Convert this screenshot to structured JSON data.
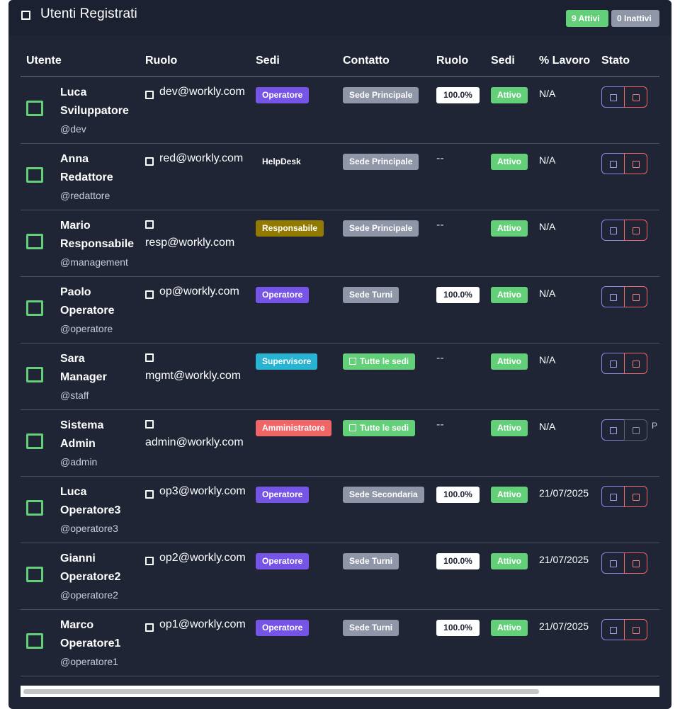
{
  "header": {
    "title": "Utenti Registrati",
    "active_badge": "9 Attivi",
    "inactive_badge": "0 Inattivi"
  },
  "columns": [
    "Utente",
    "Ruolo",
    "Sedi",
    "Contatto",
    "Ruolo",
    "Sedi",
    "% Lavoro",
    "Stato"
  ],
  "colors": {
    "card_bg": "#1f2535",
    "green": "#63cf78",
    "gray": "#8e96a8",
    "operatore": "#7654e6",
    "responsabile": "#927a00",
    "supervisore": "#28b3d2",
    "amministratore": "#f06666",
    "edit_outline": "#8d86e8",
    "delete_outline": "#f06666"
  },
  "users": [
    {
      "name_l1": "Luca",
      "name_l2": "Sviluppatore",
      "username": "@dev",
      "email": "dev@workly.com",
      "role": "Operatore",
      "role_color": "#7654e6",
      "sede": "Sede Principale",
      "sede_style": "gray",
      "perc": "100.0%",
      "stato": "Attivo",
      "lavoro": "N/A"
    },
    {
      "name_l1": "Anna",
      "name_l2": "Redattore",
      "username": "@redattore",
      "email": "red@workly.com",
      "role": "HelpDesk",
      "role_color": "transparent",
      "sede": "Sede Principale",
      "sede_style": "gray",
      "perc": "--",
      "stato": "Attivo",
      "lavoro": "N/A"
    },
    {
      "name_l1": "Mario",
      "name_l2": "Responsabile",
      "username": "@management",
      "email": "resp@workly.com",
      "role": "Responsabile",
      "role_color": "#927a00",
      "sede": "Sede Principale",
      "sede_style": "gray",
      "perc": "--",
      "stato": "Attivo",
      "lavoro": "N/A"
    },
    {
      "name_l1": "Paolo",
      "name_l2": "Operatore",
      "username": "@operatore",
      "email": "op@workly.com",
      "role": "Operatore",
      "role_color": "#7654e6",
      "sede": "Sede Turni",
      "sede_style": "gray",
      "perc": "100.0%",
      "stato": "Attivo",
      "lavoro": "N/A"
    },
    {
      "name_l1": "Sara",
      "name_l2": "Manager",
      "username": "@staff",
      "email": "mgmt@workly.com",
      "role": "Supervisore",
      "role_color": "#28b3d2",
      "sede": "Tutte le sedi",
      "sede_style": "green",
      "perc": "--",
      "stato": "Attivo",
      "lavoro": "N/A"
    },
    {
      "name_l1": "Sistema",
      "name_l2": "Admin",
      "username": "@admin",
      "email": "admin@workly.com",
      "role": "Amministratore",
      "role_color": "#f06666",
      "sede": "Tutte le sedi",
      "sede_style": "green",
      "perc": "--",
      "stato": "Attivo",
      "lavoro": "N/A",
      "peek_text": "P"
    },
    {
      "name_l1": "Luca",
      "name_l2": "Operatore3",
      "username": "@operatore3",
      "email": "op3@workly.com",
      "role": "Operatore",
      "role_color": "#7654e6",
      "sede": "Sede Secondaria",
      "sede_style": "gray",
      "perc": "100.0%",
      "stato": "Attivo",
      "lavoro": "21/07/2025"
    },
    {
      "name_l1": "Gianni",
      "name_l2": "Operatore2",
      "username": "@operatore2",
      "email": "op2@workly.com",
      "role": "Operatore",
      "role_color": "#7654e6",
      "sede": "Sede Turni",
      "sede_style": "gray",
      "perc": "100.0%",
      "stato": "Attivo",
      "lavoro": "21/07/2025"
    },
    {
      "name_l1": "Marco",
      "name_l2": "Operatore1",
      "username": "@operatore1",
      "email": "op1@workly.com",
      "role": "Operatore",
      "role_color": "#7654e6",
      "sede": "Sede Turni",
      "sede_style": "gray",
      "perc": "100.0%",
      "stato": "Attivo",
      "lavoro": "21/07/2025"
    }
  ]
}
